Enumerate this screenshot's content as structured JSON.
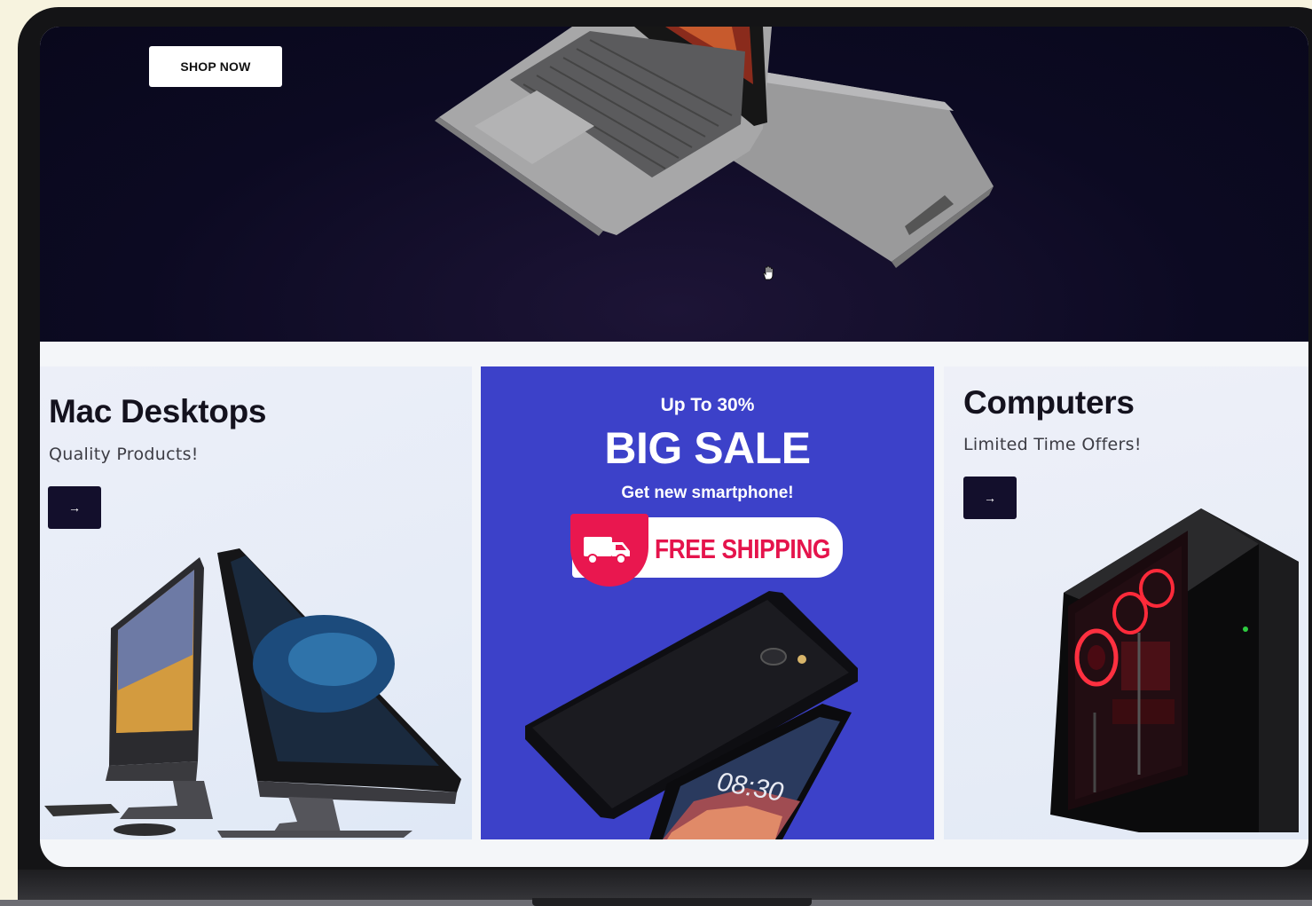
{
  "hero": {
    "shop_button_label": "SHOP NOW",
    "cursor_icon": "hand-icon"
  },
  "categories": [
    {
      "title": "Mac Desktops",
      "subtitle": "Quality Products!",
      "button_icon": "arrow-right-icon",
      "button_glyph": "→"
    },
    {
      "title": "Computers",
      "subtitle": "Limited Time Offers!",
      "button_icon": "arrow-right-icon",
      "button_glyph": "→"
    }
  ],
  "sale": {
    "top": "Up To 30%",
    "headline": "BIG SALE",
    "subline": "Get new smartphone!",
    "shipping_label": "FREE SHIPPING",
    "shipping_icon": "truck-icon",
    "phone_time": "08:30"
  },
  "colors": {
    "hero_bg": "#0c0a22",
    "sale_bg": "#3c41c9",
    "button_dark": "#130f2c",
    "shipping_red": "#e9174f"
  }
}
